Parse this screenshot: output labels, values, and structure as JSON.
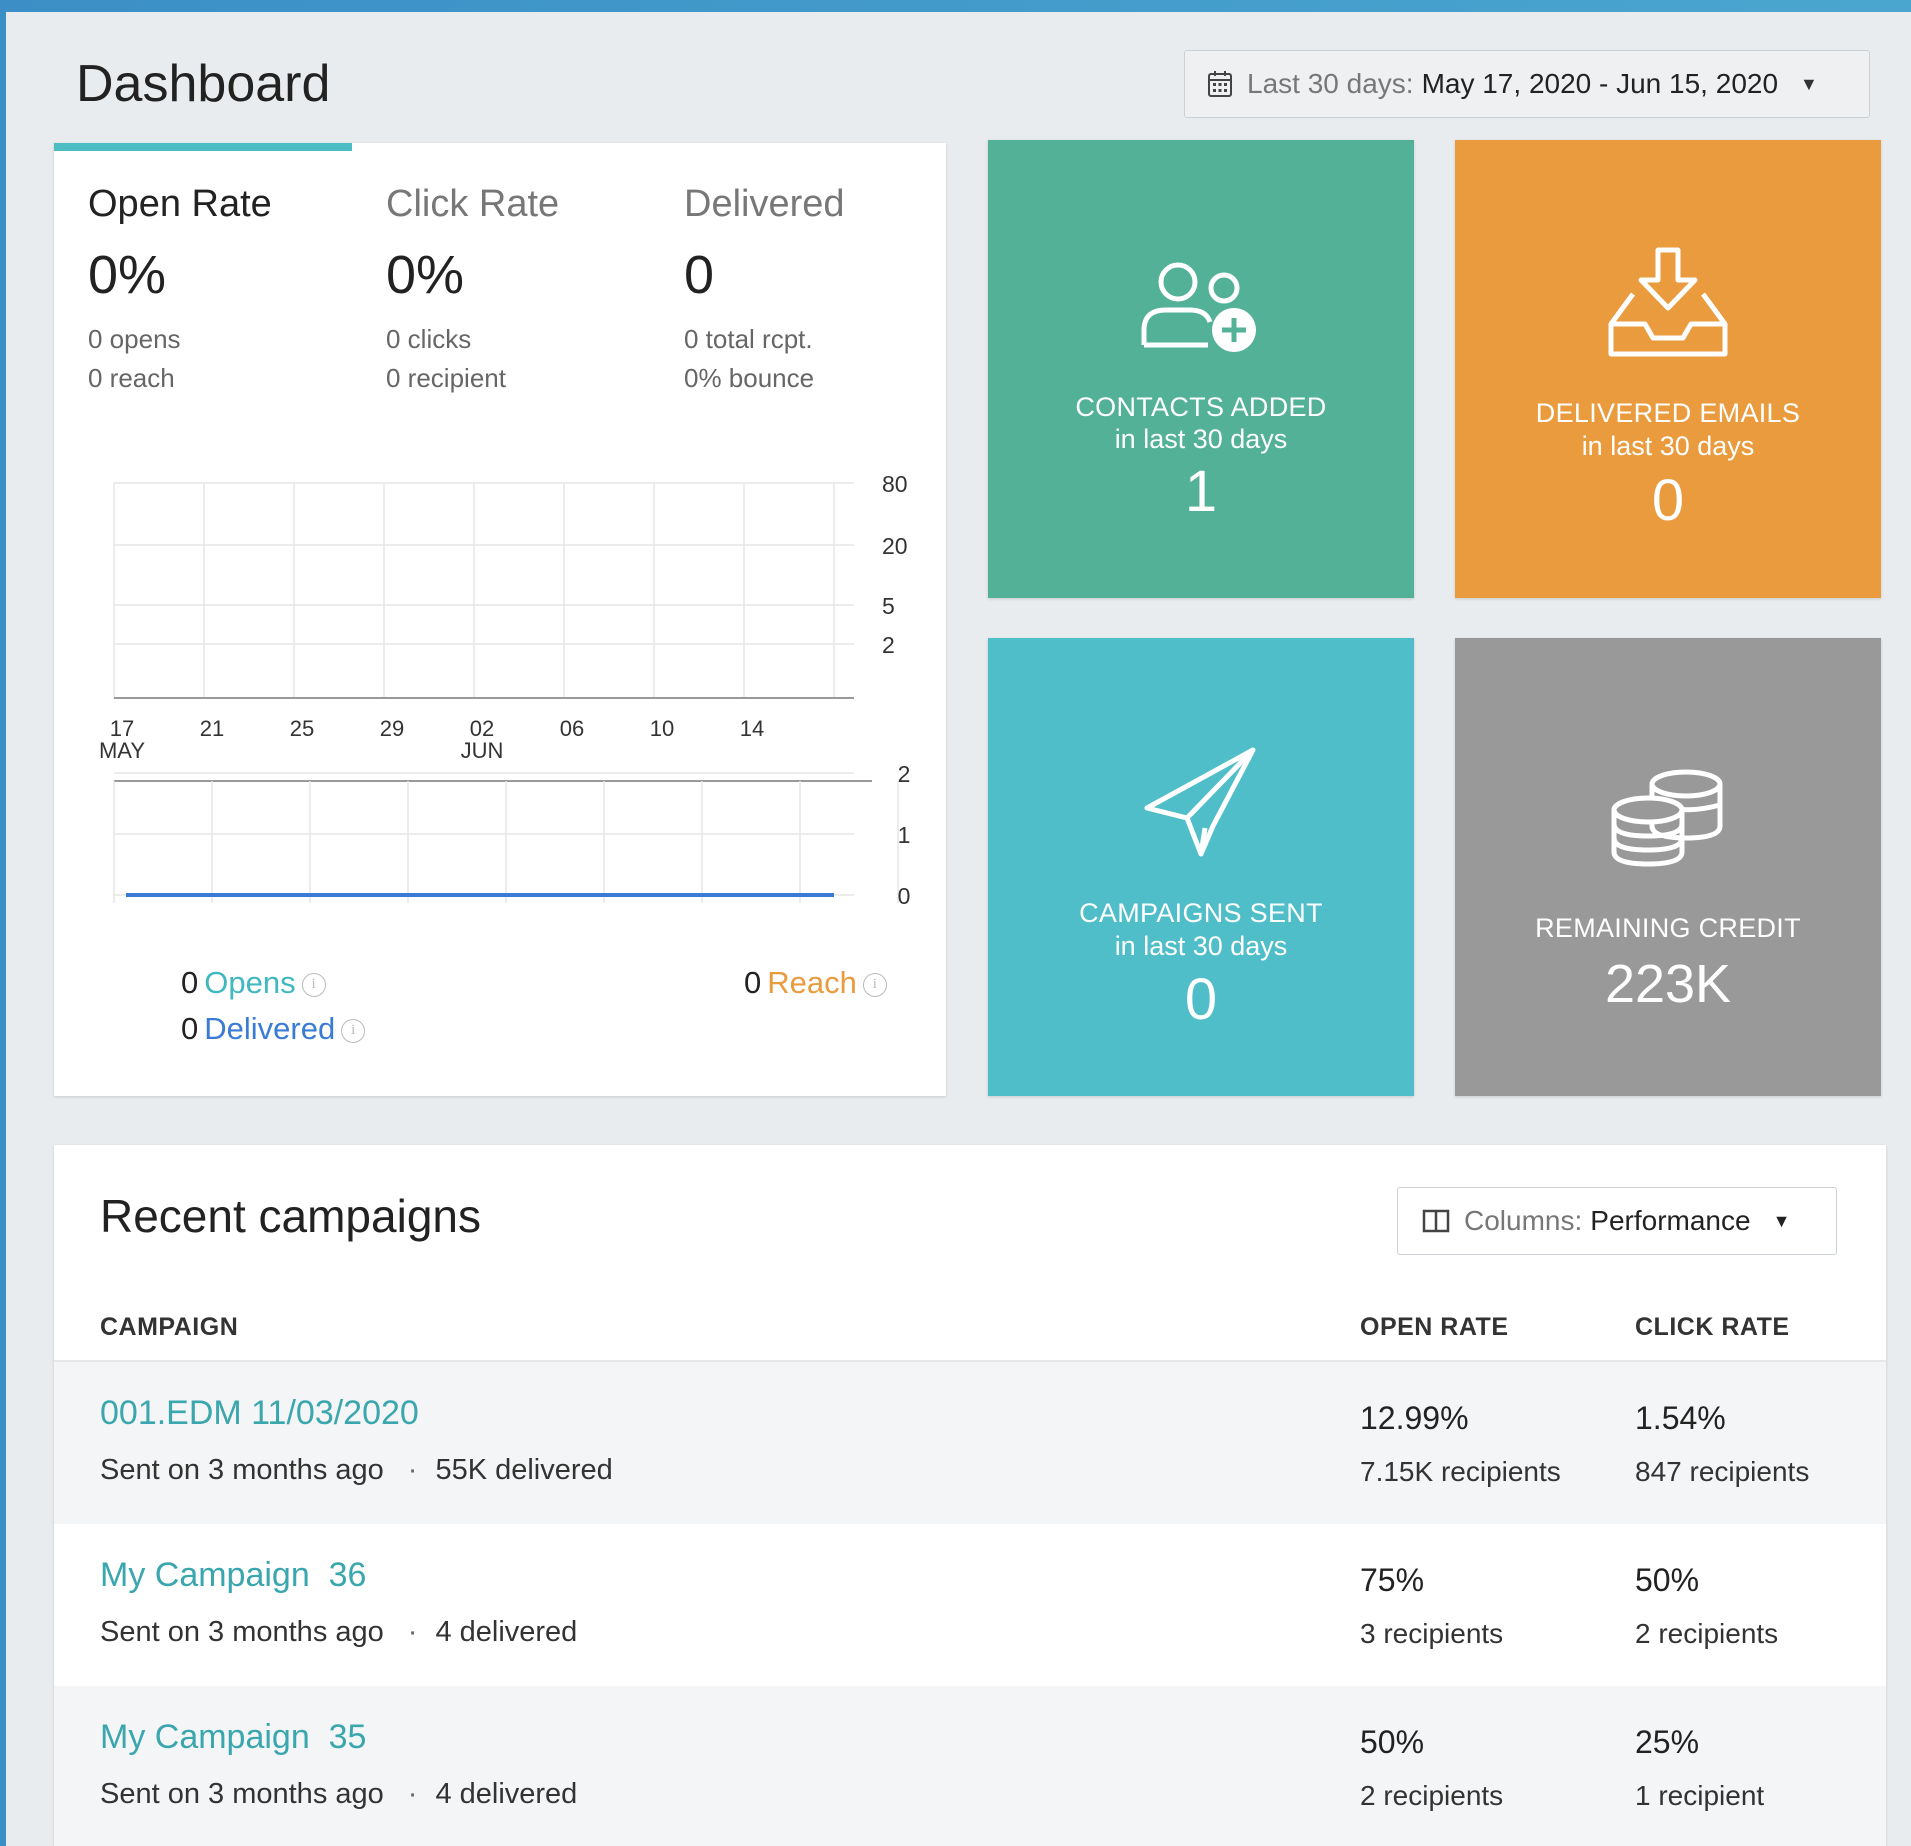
{
  "header": {
    "title": "Dashboard",
    "date_range": {
      "label": "Last 30 days:",
      "value": "May 17, 2020 - Jun 15, 2020"
    }
  },
  "stats": {
    "tabs": [
      {
        "title": "Open Rate",
        "value": "0%",
        "line1": "0 opens",
        "line2": "0 reach"
      },
      {
        "title": "Click Rate",
        "value": "0%",
        "line1": "0 clicks",
        "line2": "0 recipient"
      },
      {
        "title": "Delivered",
        "value": "0",
        "line1": "0 total rcpt.",
        "line2": "0% bounce"
      }
    ],
    "legend": {
      "opens": {
        "count": "0",
        "name": "Opens"
      },
      "delivered": {
        "count": "0",
        "name": "Delivered"
      },
      "reach": {
        "count": "0",
        "name": "Reach"
      }
    },
    "info_glyph": "i"
  },
  "chart_data": [
    {
      "type": "line",
      "x_tick_labels": [
        "17",
        "21",
        "25",
        "29",
        "02",
        "06",
        "10",
        "14"
      ],
      "x_month_labels": [
        {
          "at": "17",
          "month": "MAY"
        },
        {
          "at": "02",
          "month": "JUN"
        }
      ],
      "y_tick_labels": [
        "80",
        "20",
        "5",
        "2"
      ],
      "series": [],
      "grid": true
    },
    {
      "type": "line",
      "y_tick_labels": [
        "2",
        "1",
        "0"
      ],
      "ylim": [
        0,
        2
      ],
      "series": [
        {
          "values": [
            0,
            0,
            0,
            0,
            0,
            0,
            0,
            0,
            0,
            0,
            0,
            0,
            0,
            0,
            0,
            0,
            0,
            0,
            0,
            0,
            0,
            0,
            0,
            0,
            0,
            0,
            0,
            0,
            0,
            0
          ]
        }
      ],
      "grid": true
    }
  ],
  "tiles": {
    "contacts": {
      "line1": "CONTACTS ADDED",
      "line2": "in last 30 days",
      "value": "1",
      "icon": "add-contacts-icon",
      "color": "#52b197"
    },
    "delivered": {
      "line1": "DELIVERED EMAILS",
      "line2": "in last 30 days",
      "value": "0",
      "icon": "inbox-download-icon",
      "color": "#ea9b3e"
    },
    "campaigns": {
      "line1": "CAMPAIGNS SENT",
      "line2": "in last 30 days",
      "value": "0",
      "icon": "paper-plane-icon",
      "color": "#4fbec8"
    },
    "credit": {
      "line1": "REMAINING CREDIT",
      "value": "223K",
      "icon": "coins-icon",
      "color": "#999999"
    }
  },
  "campaigns": {
    "title": "Recent campaigns",
    "columns_button": {
      "label": "Columns:",
      "value": "Performance"
    },
    "headers": {
      "campaign": "CAMPAIGN",
      "open_rate": "OPEN RATE",
      "click_rate": "CLICK RATE"
    },
    "rows": [
      {
        "name": "001.EDM 11/03/2020",
        "sent": "Sent on 3 months ago",
        "delivered": "55K delivered",
        "open_pct": "12.99%",
        "open_rcpt": "7.15K recipients",
        "click_pct": "1.54%",
        "click_rcpt": "847 recipients"
      },
      {
        "name": "My Campaign  36",
        "sent": "Sent on 3 months ago",
        "delivered": "4 delivered",
        "open_pct": "75%",
        "open_rcpt": "3 recipients",
        "click_pct": "50%",
        "click_rcpt": "2 recipients"
      },
      {
        "name": "My Campaign  35",
        "sent": "Sent on 3 months ago",
        "delivered": "4 delivered",
        "open_pct": "50%",
        "open_rcpt": "2 recipients",
        "click_pct": "25%",
        "click_rcpt": "1 recipient"
      }
    ]
  },
  "colors": {
    "accent": "#4dbdc4",
    "opens": "#3fb8c0",
    "delivered": "#3a7bd5",
    "reach": "#ea9b3e",
    "link": "#3aa6ad"
  }
}
